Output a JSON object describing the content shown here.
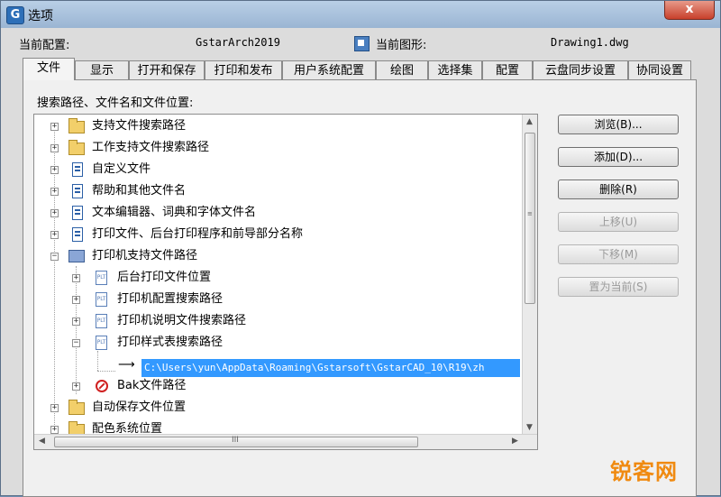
{
  "window": {
    "title": "选项",
    "close_label": "x"
  },
  "header": {
    "profile_label": "当前配置:",
    "profile_value": "GstarArch2019",
    "drawing_label": "当前图形:",
    "drawing_value": "Drawing1.dwg"
  },
  "tabs": [
    {
      "label": "文件"
    },
    {
      "label": "显示"
    },
    {
      "label": "打开和保存"
    },
    {
      "label": "打印和发布"
    },
    {
      "label": "用户系统配置"
    },
    {
      "label": "绘图"
    },
    {
      "label": "选择集"
    },
    {
      "label": "配置"
    },
    {
      "label": "云盘同步设置"
    },
    {
      "label": "协同设置"
    }
  ],
  "tree": {
    "heading": "搜索路径、文件名和文件位置:",
    "items": [
      {
        "label": "支持文件搜索路径",
        "icon": "folder-icon"
      },
      {
        "label": "工作支持文件搜索路径",
        "icon": "folder-icon"
      },
      {
        "label": "自定义文件",
        "icon": "document-icon"
      },
      {
        "label": "帮助和其他文件名",
        "icon": "document-icon"
      },
      {
        "label": "文本编辑器、词典和字体文件名",
        "icon": "document-icon"
      },
      {
        "label": "打印文件、后台打印程序和前导部分名称",
        "icon": "document-icon"
      },
      {
        "label": "打印机支持文件路径",
        "icon": "printer-icon"
      },
      {
        "label": "后台打印文件位置",
        "icon": "plot-file-icon"
      },
      {
        "label": "打印机配置搜索路径",
        "icon": "plot-file-icon"
      },
      {
        "label": "打印机说明文件搜索路径",
        "icon": "plot-file-icon"
      },
      {
        "label": "打印样式表搜索路径",
        "icon": "plot-file-icon"
      },
      {
        "label": "C:\\Users\\yun\\AppData\\Roaming\\Gstarsoft\\GstarCAD_10\\R19\\zh",
        "icon": "arrow-icon"
      },
      {
        "label": "Bak文件路径",
        "icon": "no-entry-icon"
      },
      {
        "label": "自动保存文件位置",
        "icon": "folder-icon"
      },
      {
        "label": "配色系统位置",
        "icon": "folder-icon"
      }
    ]
  },
  "buttons": {
    "browse": "浏览(B)...",
    "add": "添加(D)...",
    "remove": "删除(R)",
    "move_up": "上移(U)",
    "move_down": "下移(M)",
    "set_current": "置为当前(S)"
  },
  "scrollbars": {
    "vertical_grip": "≡",
    "horizontal_grip": "III"
  },
  "watermark": "锐客网",
  "colors": {
    "selection": "#3399ff",
    "titlebar": "#9ab5d3",
    "close_button": "#c8402b",
    "watermark": "#f08a10"
  }
}
